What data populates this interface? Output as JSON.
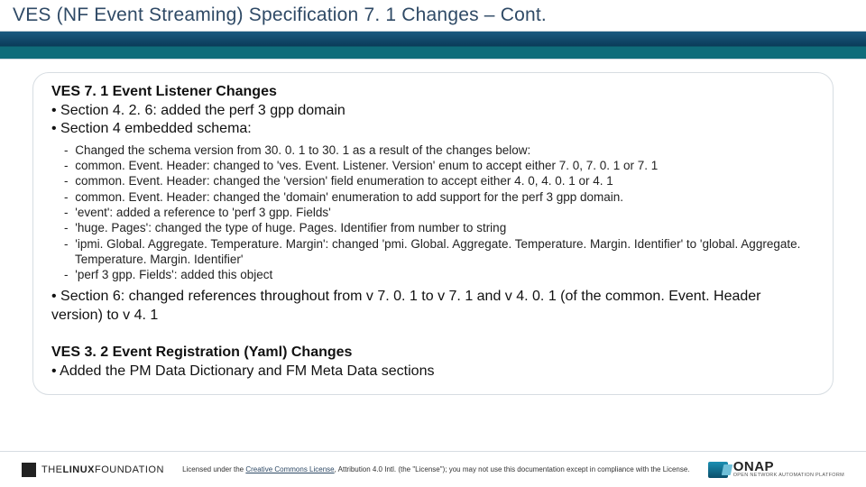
{
  "title": "VES (NF Event Streaming) Specification 7. 1 Changes – Cont.",
  "card": {
    "sectionA": {
      "heading": "VES 7. 1 Event Listener Changes",
      "bullets": [
        "Section 4. 2. 6: added the perf 3 gpp domain",
        "Section 4 embedded schema:"
      ],
      "sub": [
        "Changed the schema version from 30. 0. 1 to 30. 1 as a result of the changes below:",
        "common. Event. Header: changed to 'ves. Event. Listener. Version' enum to accept either 7. 0, 7. 0. 1 or 7. 1",
        "common. Event. Header: changed the 'version' field enumeration to accept either 4. 0, 4. 0. 1 or 4. 1",
        "common. Event. Header: changed the 'domain' enumeration to add support for the perf 3 gpp domain.",
        "'event': added a reference to 'perf 3 gpp. Fields'",
        "'huge. Pages': changed the type of huge. Pages. Identifier from number to string",
        "'ipmi. Global. Aggregate. Temperature. Margin': changed 'pmi. Global. Aggregate. Temperature. Margin. Identifier' to 'global. Aggregate. Temperature. Margin. Identifier'",
        "'perf 3 gpp. Fields': added this object"
      ],
      "bullet3": "Section 6: changed references throughout from v 7. 0. 1 to v 7. 1 and v 4. 0. 1 (of the common. Event. Header version) to v 4. 1"
    },
    "sectionB": {
      "heading": "VES 3. 2 Event Registration (Yaml) Changes",
      "bullets": [
        "Added the PM Data Dictionary and FM Meta Data sections"
      ]
    }
  },
  "footer": {
    "lf_prefix": "THE",
    "lf_name": "LINUX",
    "lf_suffix": "FOUNDATION",
    "license_pre": "Licensed under the ",
    "license_link": "Creative Commons License",
    "license_post": ", Attribution 4.0 Intl. (the \"License\"); you may not use this documentation except in compliance with the License.",
    "onap_big": "ONAP",
    "onap_small": "OPEN NETWORK AUTOMATION PLATFORM"
  }
}
